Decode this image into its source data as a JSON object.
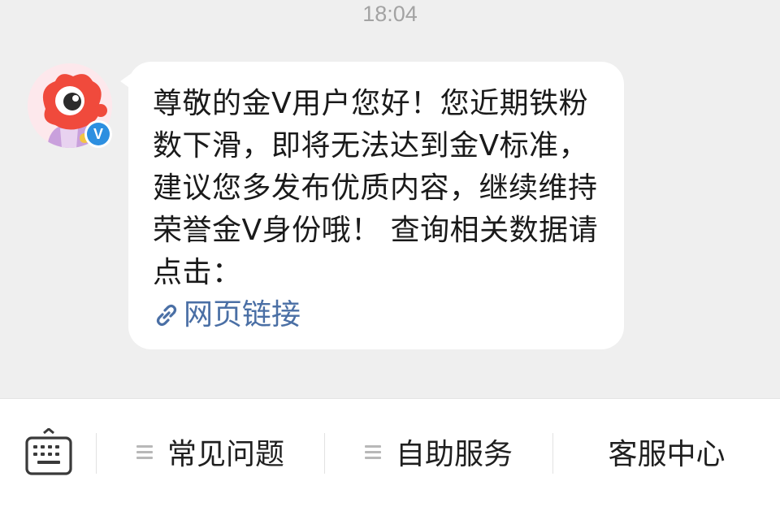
{
  "chat": {
    "timestamp": "18:04",
    "sender": {
      "badge": "V"
    },
    "message": {
      "text": "尊敬的金V用户您好！您近期铁粉数下滑，即将无法达到金V标准，建议您多发布优质内容，继续维持荣誉金V身份哦！ 查询相关数据请点击：",
      "link_label": "网页链接"
    }
  },
  "bottom_menu": {
    "items": [
      {
        "label": "常见问题"
      },
      {
        "label": "自助服务"
      },
      {
        "label": "客服中心"
      }
    ]
  },
  "colors": {
    "background": "#efefef",
    "bubble": "#ffffff",
    "link": "#4a6fa5",
    "verified": "#2d8fe0",
    "mascot": "#f04a3c"
  },
  "icons": {
    "keyboard": "keyboard-icon",
    "link": "link-icon",
    "menu": "menu-lines-icon"
  }
}
